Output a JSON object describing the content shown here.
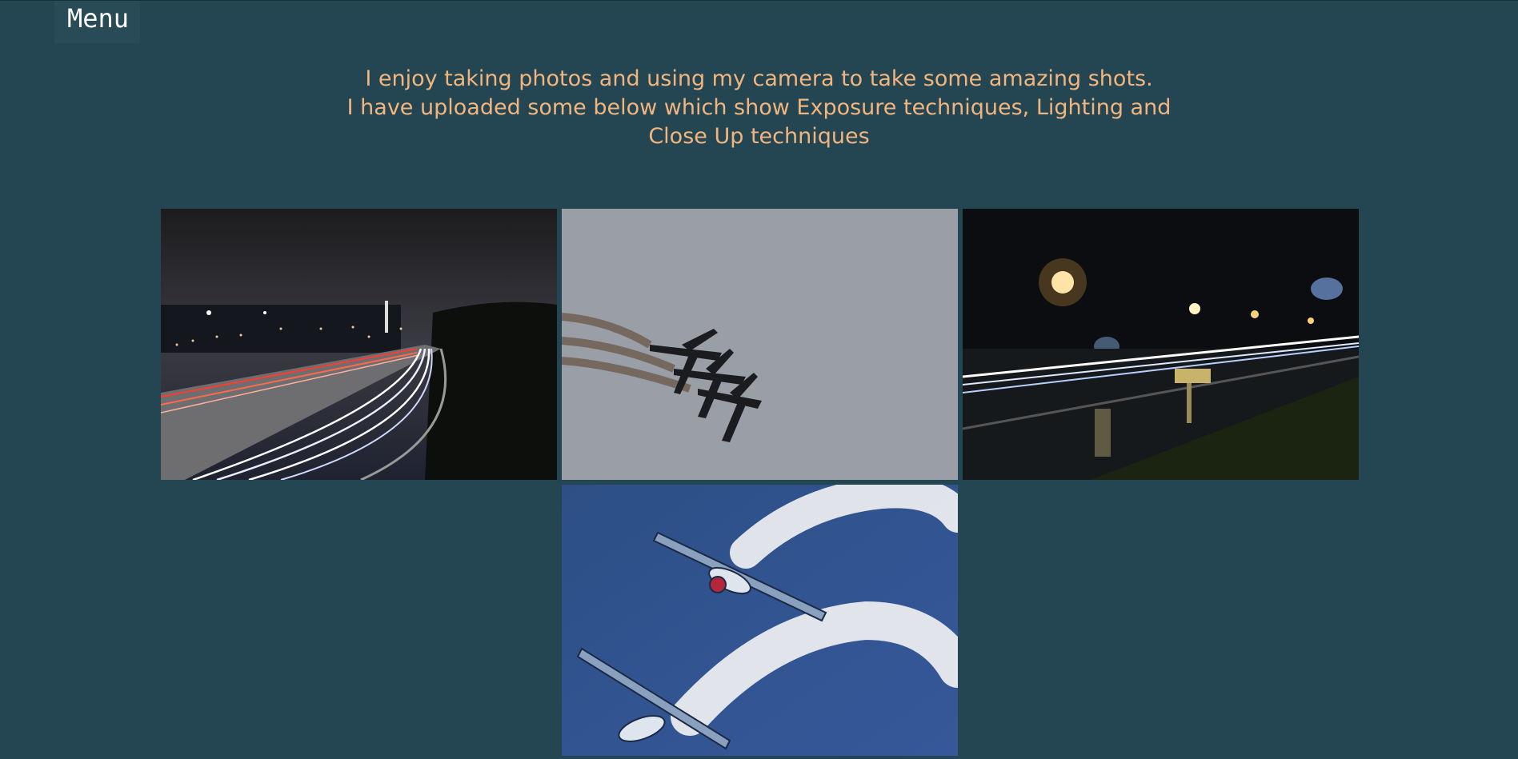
{
  "nav": {
    "menu_label": "Menu"
  },
  "intro": {
    "line1": "I enjoy taking photos and using my camera to take some amazing shots.",
    "line2": "I have uploaded some below which show Exposure techniques, Lighting and",
    "line3": "Close Up techniques"
  },
  "colors": {
    "background": "#244652",
    "intro_text": "#f2b57e",
    "menu_text": "#ffffff"
  },
  "gallery": [
    {
      "subject": "night city highway light trails"
    },
    {
      "subject": "three planes with smoke trails"
    },
    {
      "subject": "night road light trails with street lamps"
    },
    {
      "subject": "two aerobatic planes with white smoke"
    }
  ]
}
